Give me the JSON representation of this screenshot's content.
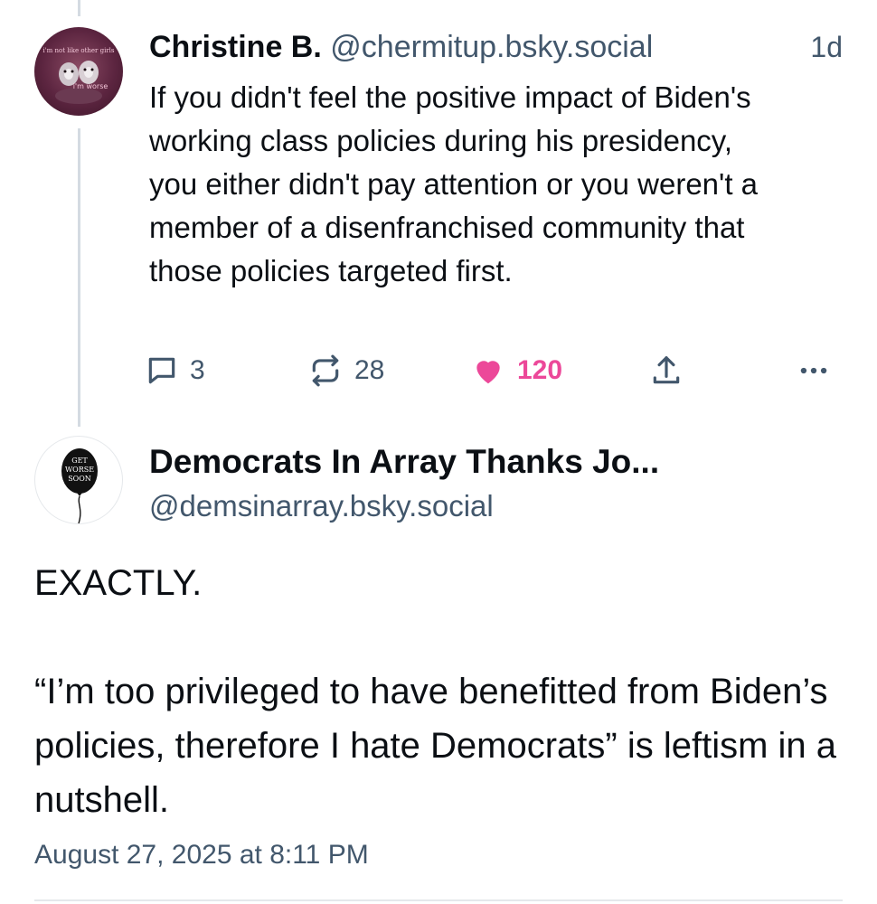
{
  "parent_post": {
    "author_name": "Christine B.",
    "author_handle": "@chermitup.bsky.social",
    "time_ago": "1d",
    "text": "If you didn't feel the positive impact of Biden's working class policies during his presidency, you either didn't pay attention or you weren't a member of a disenfranchised community that those policies targeted first.",
    "avatar": {
      "caption_top": "i'm not like other girls",
      "caption_bottom": "i'm worse"
    },
    "actions": {
      "replies": "3",
      "reposts": "28",
      "likes": "120"
    }
  },
  "main_post": {
    "author_name": "Democrats In Array Thanks Jo...",
    "author_handle": "@demsinarray.bsky.social",
    "avatar": {
      "balloon_text_1": "GET",
      "balloon_text_2": "WORSE",
      "balloon_text_3": "SOON"
    },
    "text_line1": "EXACTLY.",
    "text_line2": "“I’m too privileged to have benefitted from Biden’s policies, therefore I hate Democrats” is leftism in a nutshell.",
    "timestamp": "August 27, 2025 at 8:11 PM"
  },
  "icons": {
    "reply": "speech-bubble-icon",
    "repost": "repost-arrows-icon",
    "like": "heart-icon",
    "share": "share-upload-icon",
    "more": "more-dots-icon"
  },
  "colors": {
    "text": "#0b0f14",
    "secondary_text": "#42576c",
    "like_active": "#ec4899",
    "thread_line": "#d4dbe2"
  }
}
